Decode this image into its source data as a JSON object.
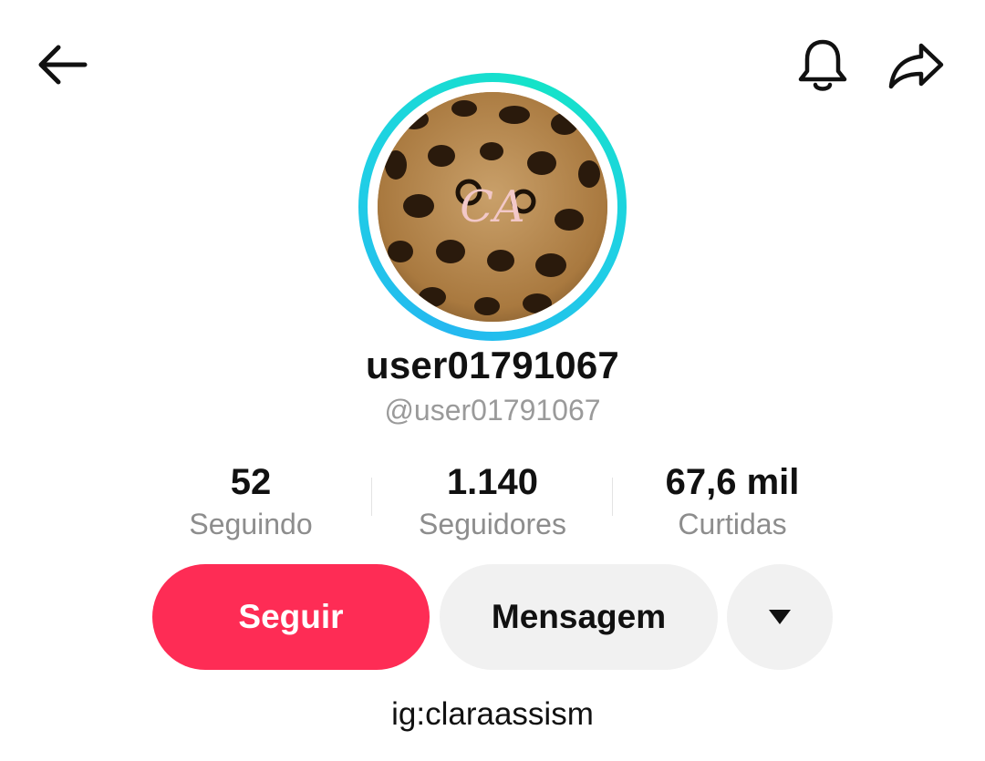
{
  "header": {
    "back_icon": "arrow-left-icon",
    "notification_icon": "bell-icon",
    "share_icon": "share-arrow-icon"
  },
  "profile": {
    "avatar_monogram": "CA",
    "display_name": "user01791067",
    "handle": "@user01791067",
    "bio": "ig:claraassism"
  },
  "stats": [
    {
      "value": "52",
      "label": "Seguindo"
    },
    {
      "value": "1.140",
      "label": "Seguidores"
    },
    {
      "value": "67,6 mil",
      "label": "Curtidas"
    }
  ],
  "actions": {
    "follow_label": "Seguir",
    "message_label": "Mensagem",
    "more_icon": "triangle-down-icon"
  },
  "colors": {
    "follow_button": "#fe2c55",
    "secondary_button": "#f1f1f1",
    "ring_gradient_start": "#24b8f0",
    "ring_gradient_end": "#14e3c8",
    "muted_text": "#8d8d8d"
  }
}
